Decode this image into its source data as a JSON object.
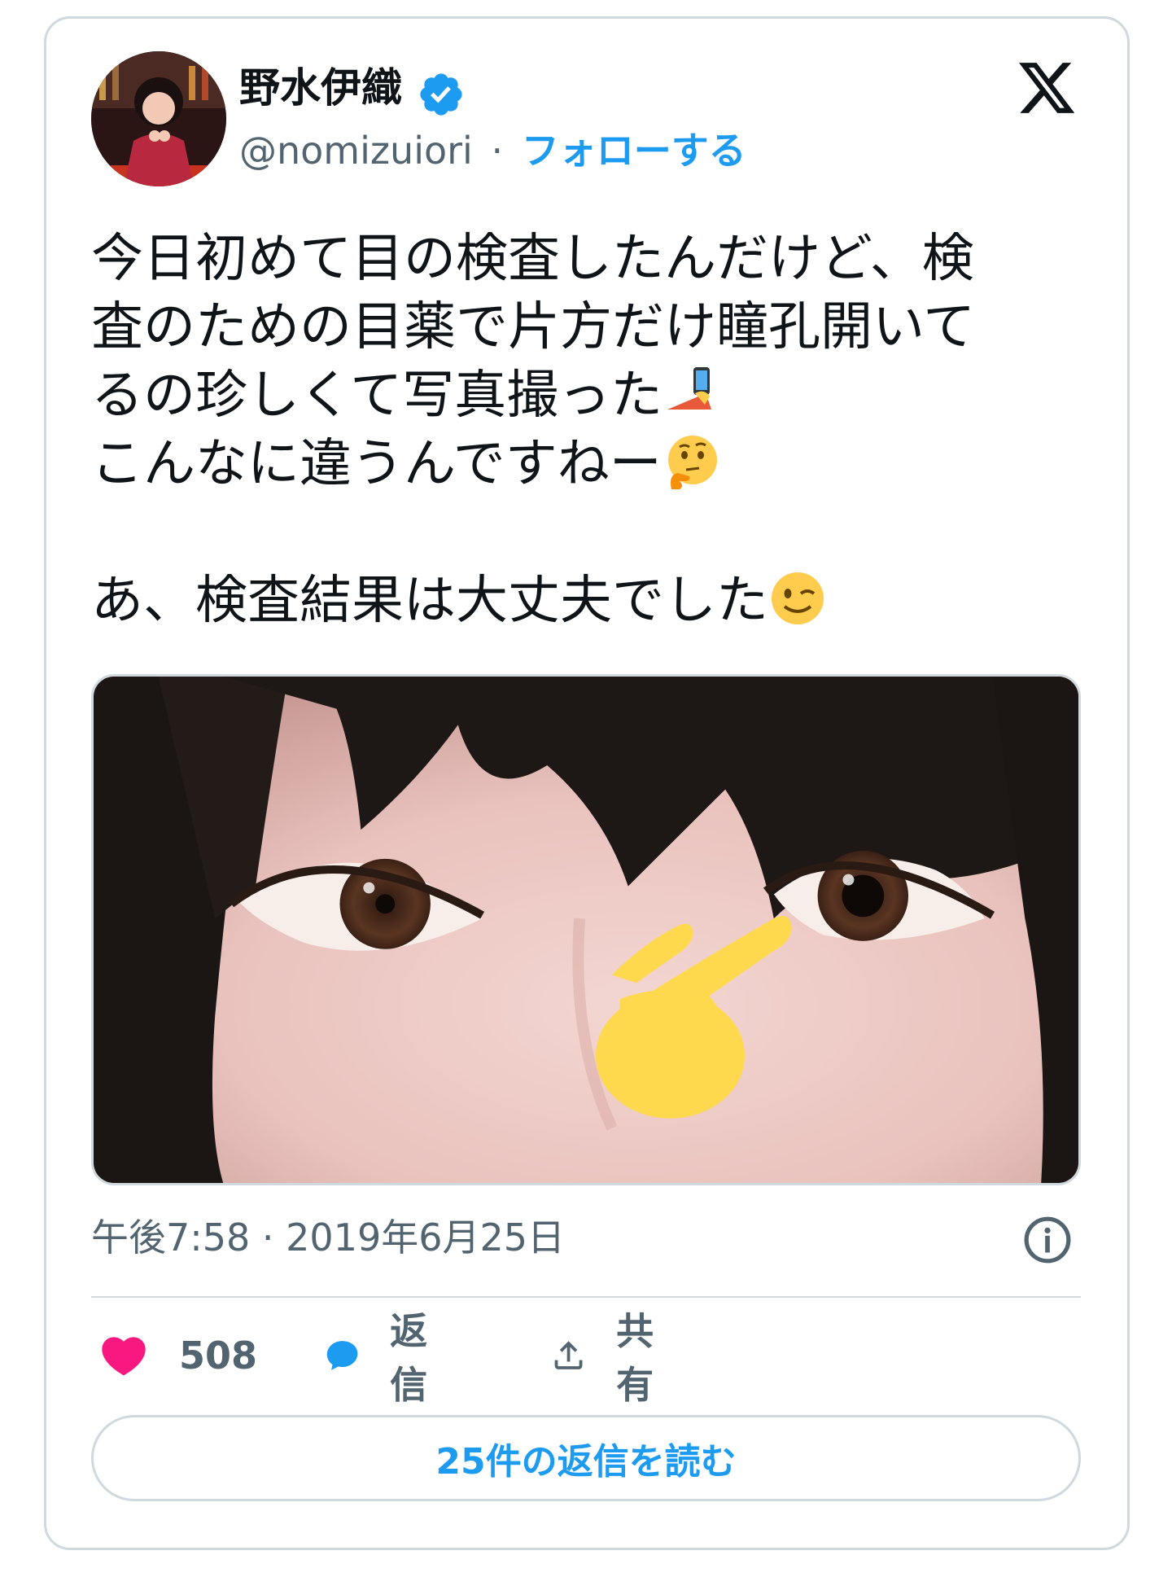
{
  "author": {
    "display_name": "野水伊織",
    "handle": "@nomizuiori",
    "separator": "·",
    "follow_label": "フォローする"
  },
  "tweet": {
    "line1": "今日初めて目の検査したんだけど、検",
    "line2": "査のための目薬で片方だけ瞳孔開いて",
    "line3": "るの珍しくて写真撮った",
    "line4": "こんなに違うんですねー",
    "line5": "あ、検査結果は大丈夫でした",
    "emojis": [
      "selfie-emoji",
      "thinking-face-emoji",
      "winking-face-emoji"
    ]
  },
  "meta": {
    "timestamp": "午後7:58 · 2019年6月25日"
  },
  "actions": {
    "likes_count": "508",
    "reply_label": "返信",
    "share_label": "共有"
  },
  "read_replies_label": "25件の返信を読む",
  "colors": {
    "accent": "#1d9bf0",
    "like": "#f91880",
    "muted_text": "#536471",
    "border": "#cfd9de"
  }
}
